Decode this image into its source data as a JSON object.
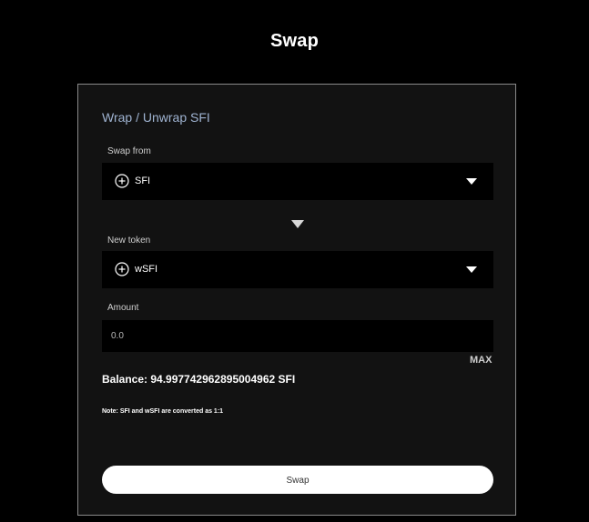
{
  "page": {
    "title": "Swap"
  },
  "panel": {
    "heading": "Wrap / Unwrap SFI",
    "swap_from": {
      "label": "Swap from",
      "token": "SFI",
      "icon": "plus-circle-icon"
    },
    "swap_direction_icon": "triangle-down-icon",
    "new_token": {
      "label": "New token",
      "token": "wSFI",
      "icon": "plus-circle-icon"
    },
    "amount": {
      "label": "Amount",
      "value": "",
      "placeholder": "0.0",
      "max_label": "MAX"
    },
    "balance": "Balance: 94.997742962895004962 SFI",
    "note": "Note: SFI and wSFI are converted as 1:1",
    "swap_button_label": "Swap"
  },
  "colors": {
    "background": "#000000",
    "panel": "#121212",
    "panel_border": "#8a8a8a",
    "heading": "#9fb3d1",
    "button": "#ffffff"
  }
}
